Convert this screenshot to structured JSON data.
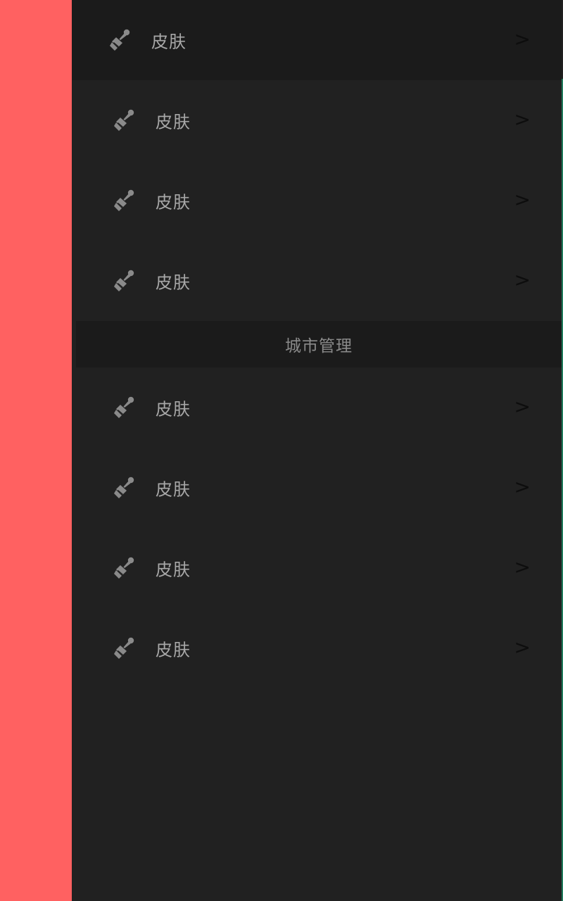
{
  "menu_group_1": [
    {
      "label": "皮肤",
      "icon": "brush-icon",
      "chevron": ">"
    },
    {
      "label": "皮肤",
      "icon": "brush-icon",
      "chevron": ">"
    },
    {
      "label": "皮肤",
      "icon": "brush-icon",
      "chevron": ">"
    },
    {
      "label": "皮肤",
      "icon": "brush-icon",
      "chevron": ">"
    }
  ],
  "section_header": "城市管理",
  "menu_group_2": [
    {
      "label": "皮肤",
      "icon": "brush-icon",
      "chevron": ">"
    },
    {
      "label": "皮肤",
      "icon": "brush-icon",
      "chevron": ">"
    },
    {
      "label": "皮肤",
      "icon": "brush-icon",
      "chevron": ">"
    },
    {
      "label": "皮肤",
      "icon": "brush-icon",
      "chevron": ">"
    }
  ],
  "colors": {
    "left_panel": "#ff6161",
    "drawer_bg": "#212121",
    "selected_row_bg": "#1b1b1b",
    "label_text": "#a8a8a8",
    "icon": "#8a8a8a",
    "accent_edge": "#1f7a5b"
  }
}
